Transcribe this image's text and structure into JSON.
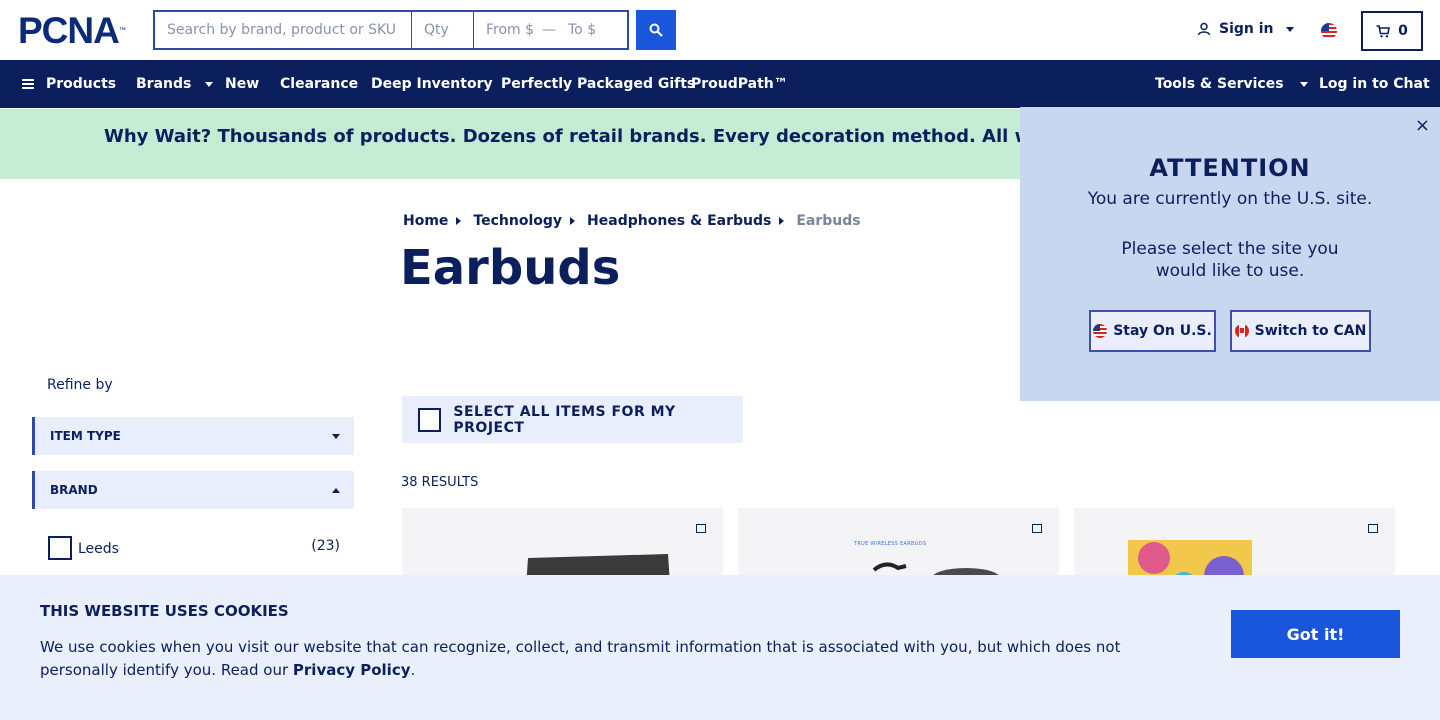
{
  "header": {
    "logo_text": "PCNA",
    "logo_tm": "™",
    "search_placeholder": "Search by brand, product or SKU",
    "qty_placeholder": "Qty",
    "from_placeholder": "From $",
    "to_placeholder": "To $",
    "signin_label": "Sign in",
    "cart_count": "0"
  },
  "nav": {
    "products": "Products",
    "brands": "Brands",
    "new": "New",
    "clearance": "Clearance",
    "deep_inventory": "Deep Inventory",
    "gifts": "Perfectly Packaged Gifts",
    "proudpath": "ProudPath™",
    "tools": "Tools & Services",
    "chat": "Log in to Chat"
  },
  "promo": {
    "text": "Why Wait? Thousands of products. Dozens of retail brands. Every decoration method. All with a standard"
  },
  "breadcrumb": {
    "home": "Home",
    "technology": "Technology",
    "headphones": "Headphones & Earbuds",
    "current": "Earbuds"
  },
  "page": {
    "title": "Earbuds"
  },
  "filters": {
    "refine_label": "Refine by",
    "item_type": "ITEM TYPE",
    "brand": "BRAND",
    "options": [
      {
        "label": "Leeds",
        "count": "(23)"
      }
    ]
  },
  "results": {
    "select_all": "SELECT ALL ITEMS FOR MY PROJECT",
    "count_text": "38 RESULTS",
    "card2_caption": "TRUE WIRELESS EARBUDS"
  },
  "cookie": {
    "title": "THIS WEBSITE USES COOKIES",
    "body": "We use cookies when you visit our website that can recognize, collect, and transmit information that is associated with you, but which does not personally identify you. Read our ",
    "link": "Privacy Policy",
    "end": ".",
    "button": "Got it!"
  },
  "attention": {
    "title": "ATTENTION",
    "line1": "You are currently on the U.S. site.",
    "line2": "Please select the site you would like to use.",
    "stay": "Stay On U.S.",
    "switch": "Switch to CAN",
    "close": "×"
  },
  "colors": {
    "navy": "#0b1f5c",
    "accent_blue": "#1a56db",
    "promo_green": "#c4ecd4",
    "popup_bg": "#c9d6f0",
    "cookie_bg": "#eaf0fb"
  }
}
